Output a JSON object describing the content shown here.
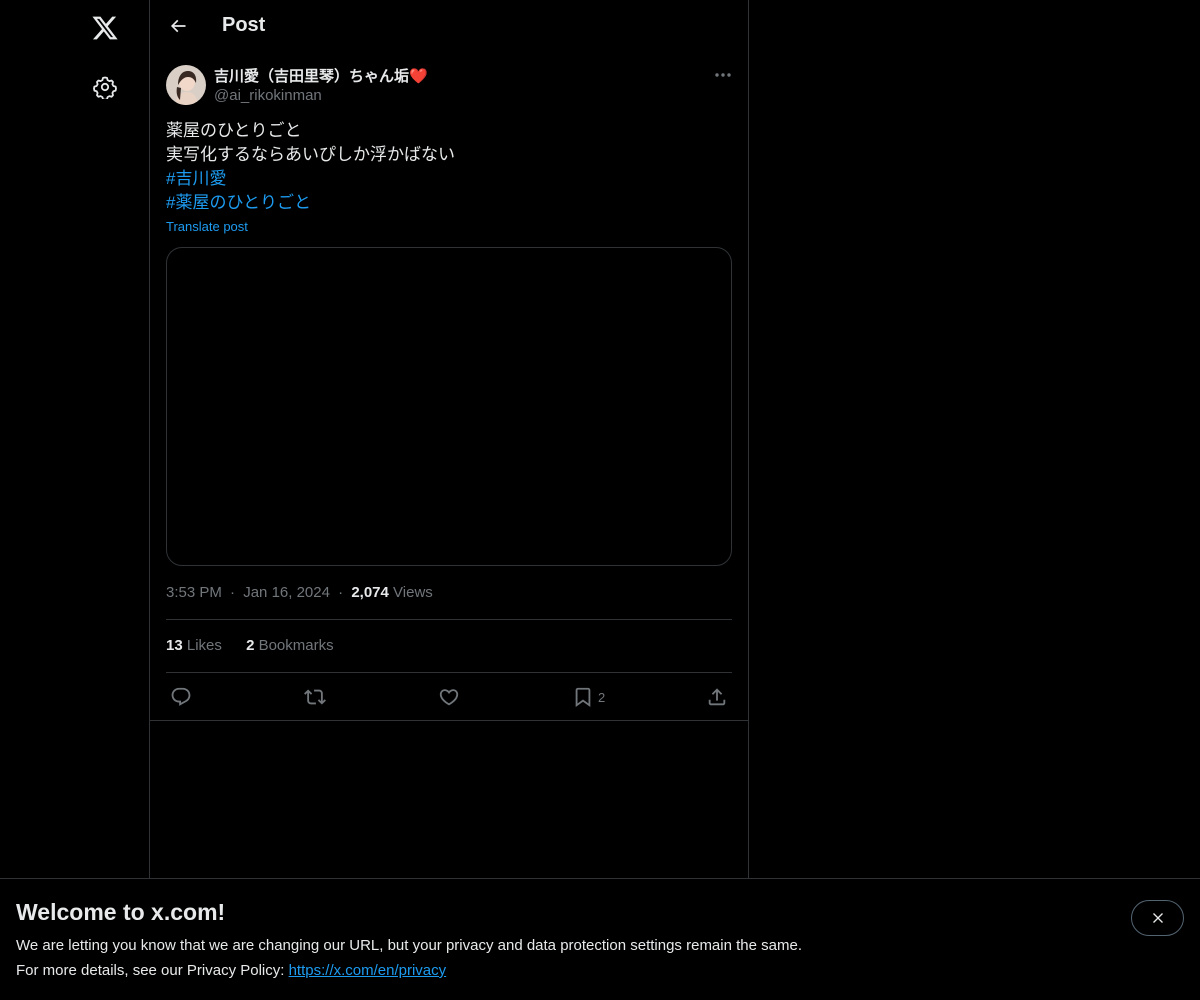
{
  "nav": {
    "logo_icon": "x-logo-icon",
    "settings_icon": "gear-icon"
  },
  "header": {
    "title": "Post",
    "back_icon": "arrow-left-icon"
  },
  "post": {
    "author_name": "吉川愛（吉田里琴）ちゃん垢",
    "author_emoji": "❤️",
    "author_handle": "@ai_rikokinman",
    "text_lines": [
      "薬屋のひとりごと",
      "実写化するならあいぴしか浮かばない"
    ],
    "hashtags": [
      "#吉川愛",
      "#薬屋のひとりごと"
    ],
    "translate_label": "Translate post",
    "time": "3:53 PM",
    "date": "Jan 16, 2024",
    "dot": "·",
    "views_count": "2,074",
    "views_label": "Views",
    "likes_count": "13",
    "likes_label": "Likes",
    "bookmarks_count": "2",
    "bookmarks_label": "Bookmarks",
    "actions": {
      "reply_icon": "reply-icon",
      "repost_icon": "repost-icon",
      "like_icon": "heart-icon",
      "bookmark_icon": "bookmark-icon",
      "bookmark_count": "2",
      "share_icon": "share-icon"
    }
  },
  "banner": {
    "title": "Welcome to x.com!",
    "line1": "We are letting you know that we are changing our URL, but your privacy and data protection settings remain the same.",
    "line2_prefix": "For more details, see our Privacy Policy: ",
    "link": "https://x.com/en/privacy",
    "close_icon": "close-icon"
  },
  "colors": {
    "background": "#000000",
    "text": "#e7e9ea",
    "muted": "#71767b",
    "accent": "#1d9bf0",
    "border": "#2f3336"
  }
}
